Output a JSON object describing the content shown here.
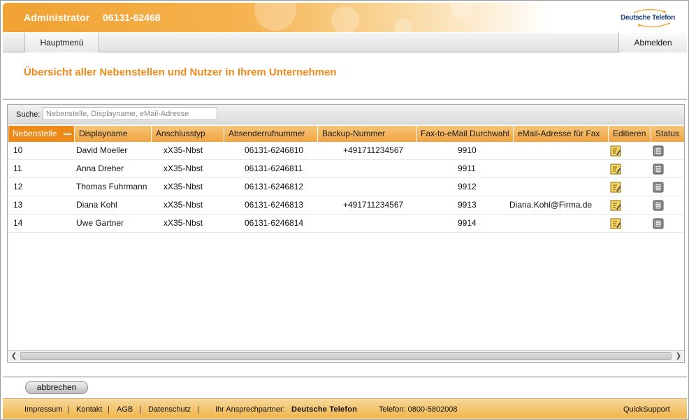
{
  "header": {
    "user_role": "Administrator",
    "account_number": "06131-62468",
    "logo_text": "Deutsche Telefon"
  },
  "nav": {
    "main_menu": "Hauptmenü",
    "logout": "Abmelden"
  },
  "page": {
    "title": "Übersicht aller Nebenstellen und Nutzer in Ihrem Unternehmen"
  },
  "search": {
    "label": "Suche:",
    "placeholder": "Nebenstelle, Displayname, eMail-Adresse",
    "value": ""
  },
  "grid": {
    "columns": [
      "Nebenstelle",
      "Displayname",
      "Anschlusstyp",
      "Absenderrufnummer",
      "Backup-Nummer",
      "Fax-to-eMail Durchwahl",
      "eMail-Adresse für Fax",
      "Editieren",
      "Status"
    ],
    "sorted_column": "Nebenstelle",
    "rows": [
      {
        "nebenstelle": "10",
        "displayname": "David Moeller",
        "anschlusstyp": "xX35-Nbst",
        "absender": "06131-6246810",
        "backup": "+491711234567",
        "fax_durchwahl": "9910",
        "fax_email": ""
      },
      {
        "nebenstelle": "11",
        "displayname": "Anna Dreher",
        "anschlusstyp": "xX35-Nbst",
        "absender": "06131-6246811",
        "backup": "",
        "fax_durchwahl": "9911",
        "fax_email": ""
      },
      {
        "nebenstelle": "12",
        "displayname": "Thomas Fuhrmann",
        "anschlusstyp": "xX35-Nbst",
        "absender": "06131-6246812",
        "backup": "",
        "fax_durchwahl": "9912",
        "fax_email": ""
      },
      {
        "nebenstelle": "13",
        "displayname": "Diana Kohl",
        "anschlusstyp": "xX35-Nbst",
        "absender": "06131-6246813",
        "backup": "+491711234567",
        "fax_durchwahl": "9913",
        "fax_email": "Diana.Kohl@Firma.de"
      },
      {
        "nebenstelle": "14",
        "displayname": "Uwe Gartner",
        "anschlusstyp": "xX35-Nbst",
        "absender": "06131-6246814",
        "backup": "",
        "fax_durchwahl": "9914",
        "fax_email": ""
      }
    ],
    "edit_icon": "edit-note-icon",
    "status_icon": "status-device-icon"
  },
  "actions": {
    "cancel": "abbrechen"
  },
  "footer": {
    "impressum": "Impressum",
    "kontakt": "Kontakt",
    "agb": "AGB",
    "datenschutz": "Datenschutz",
    "contact_label": "Ihr Ansprechpartner:",
    "contact_brand": "Deutsche Telefon",
    "phone": "Telefon: 0800-5802008",
    "quicksupport": "QuickSupport"
  },
  "colors": {
    "accent_orange": "#ee8a1a",
    "header_orange": "#f0a232",
    "brand_blue": "#1d3f7a"
  }
}
